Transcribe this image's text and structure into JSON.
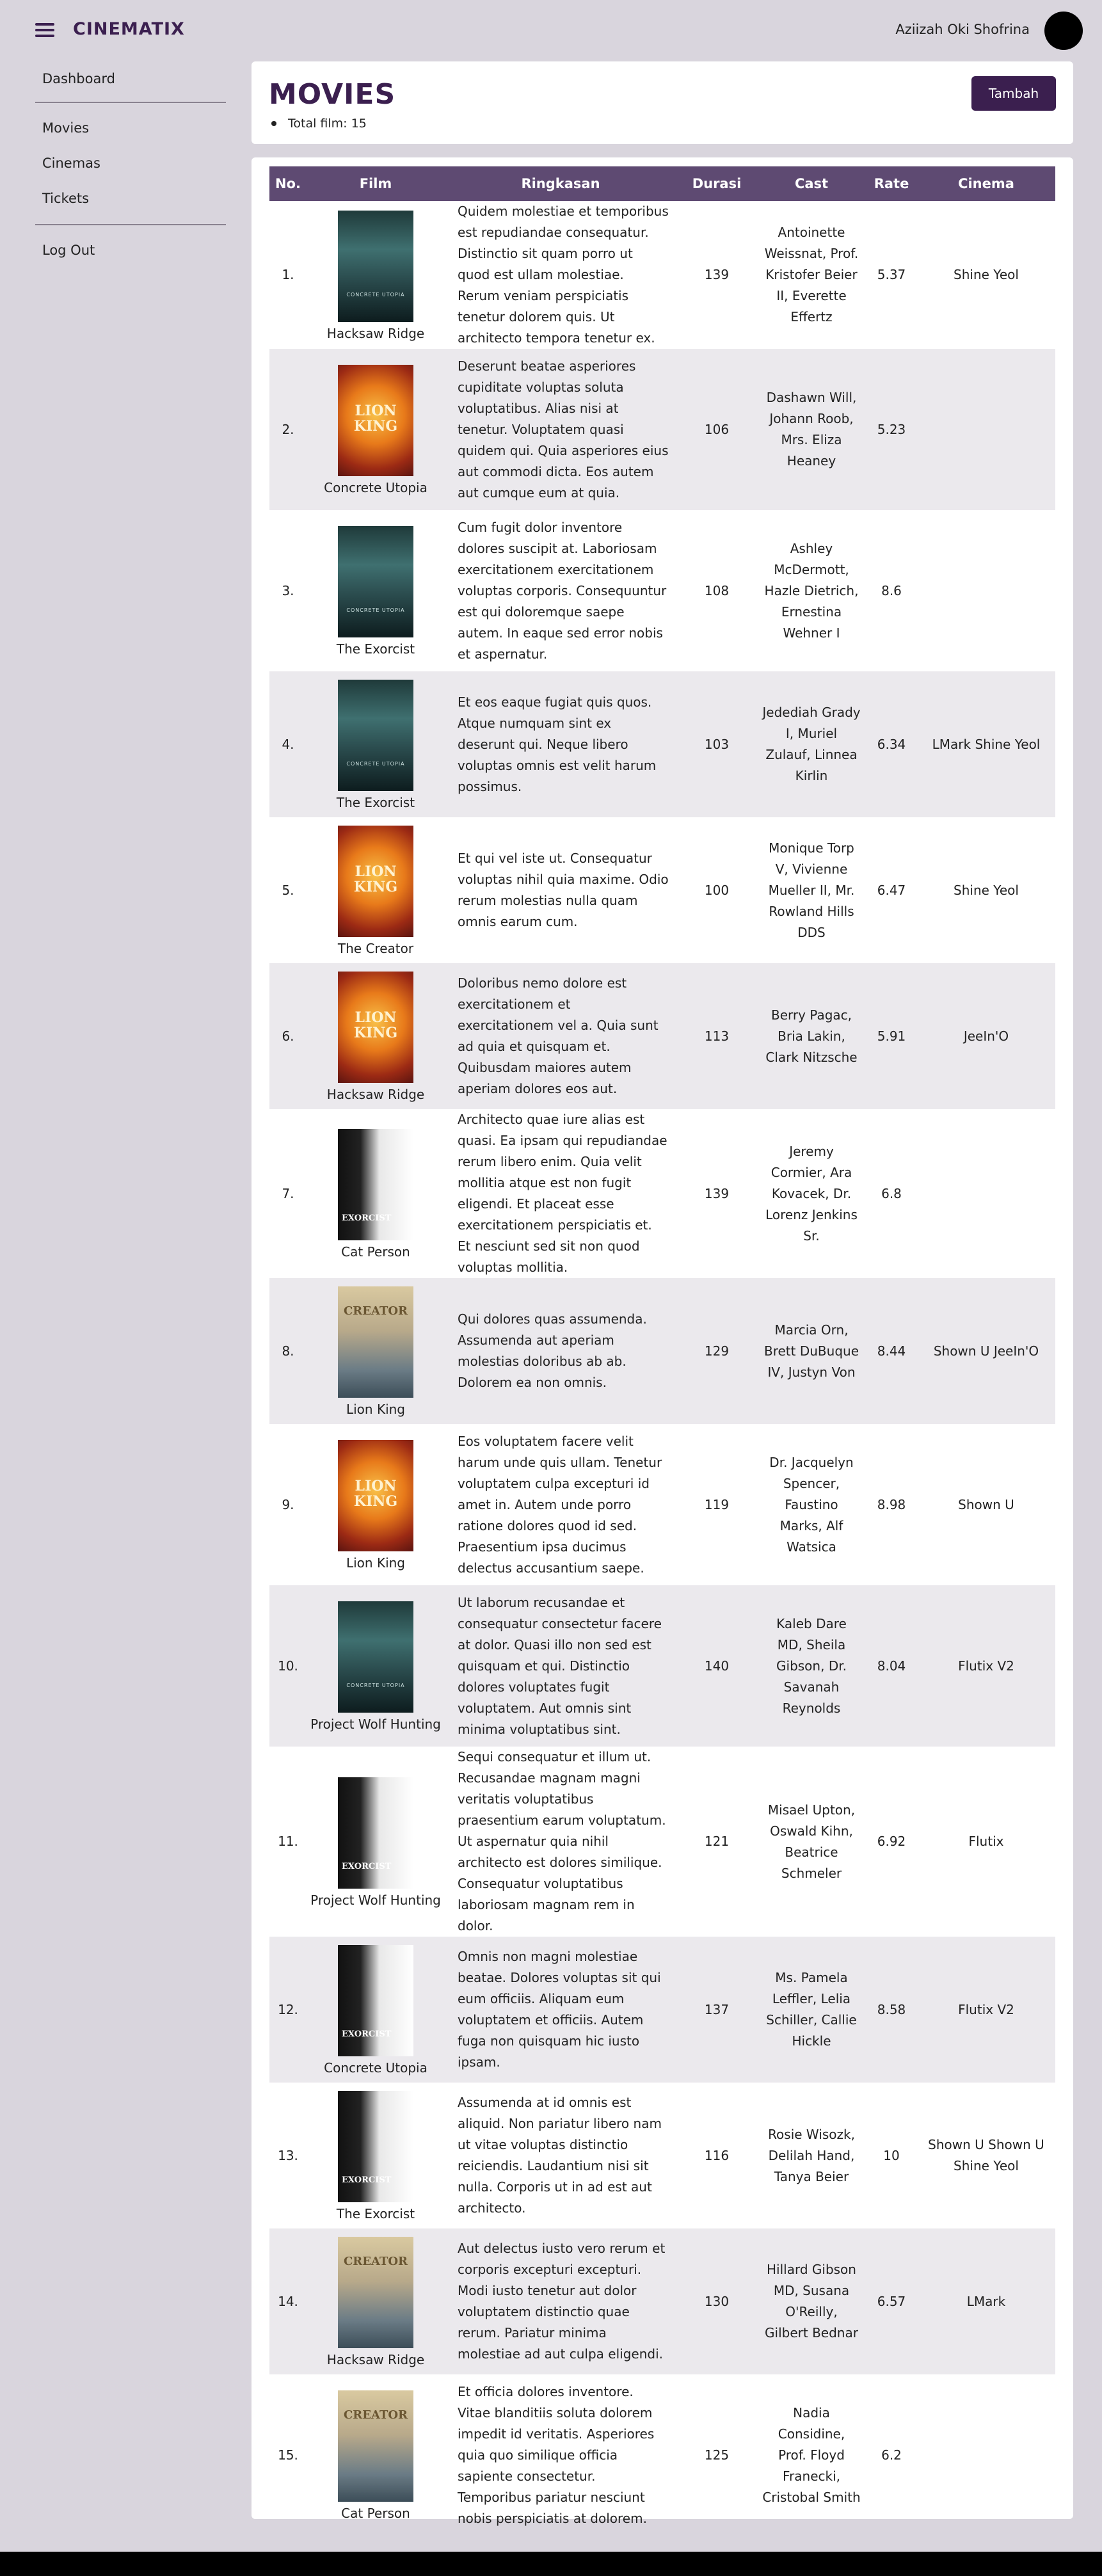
{
  "app": {
    "brand": "CINEMATIX",
    "user_name": "Aziizah Oki Shofrina"
  },
  "sidebar": {
    "items": [
      {
        "label": "Dashboard"
      },
      {
        "label": "Movies"
      },
      {
        "label": "Cinemas"
      },
      {
        "label": "Tickets"
      },
      {
        "label": "Log Out"
      }
    ]
  },
  "header": {
    "title": "MOVIES",
    "total_label": "Total film: 15",
    "add_button": "Tambah"
  },
  "table": {
    "columns": [
      "No.",
      "Film",
      "Ringkasan",
      "Durasi",
      "Cast",
      "Rate",
      "Cinema"
    ],
    "rows": [
      {
        "no": "1.",
        "poster": "concrete-utopia-poster",
        "film": "Hacksaw Ridge",
        "ringkasan": "Quidem molestiae et temporibus est repudiandae consequatur. Distinctio sit quam porro ut quod est ullam molestiae. Rerum veniam perspiciatis tenetur dolorem quis. Ut architecto tempora tenetur ex.",
        "durasi": "139",
        "cast": "Antoinette Weissnat, Prof. Kristofer Beier II, Everette Effertz",
        "rate": "5.37",
        "cinema": "Shine Yeol"
      },
      {
        "no": "2.",
        "poster": "lion-king-poster",
        "film": "Concrete Utopia",
        "ringkasan": "Deserunt beatae asperiores cupiditate voluptas soluta voluptatibus. Alias nisi at tenetur. Voluptatem quasi quidem qui. Quia asperiores eius aut commodi dicta. Eos autem aut cumque eum at quia.",
        "durasi": "106",
        "cast": "Dashawn Will, Johann Roob, Mrs. Eliza Heaney",
        "rate": "5.23",
        "cinema": ""
      },
      {
        "no": "3.",
        "poster": "concrete-utopia-poster",
        "film": "The Exorcist",
        "ringkasan": "Cum fugit dolor inventore dolores suscipit at. Laboriosam exercitationem exercitationem voluptas corporis. Consequuntur est qui doloremque saepe autem. In eaque sed error nobis et aspernatur.",
        "durasi": "108",
        "cast": "Ashley McDermott, Hazle Dietrich, Ernestina Wehner I",
        "rate": "8.6",
        "cinema": ""
      },
      {
        "no": "4.",
        "poster": "concrete-utopia-poster",
        "film": "The Exorcist",
        "ringkasan": "Et eos eaque fugiat quis quos. Atque numquam sint ex deserunt qui. Neque libero voluptas omnis est velit harum possimus.",
        "durasi": "103",
        "cast": "Jedediah Grady I, Muriel Zulauf, Linnea Kirlin",
        "rate": "6.34",
        "cinema": "LMark Shine Yeol"
      },
      {
        "no": "5.",
        "poster": "lion-king-poster",
        "film": "The Creator",
        "ringkasan": "Et qui vel iste ut. Consequatur voluptas nihil quia maxime. Odio rerum molestias nulla quam omnis earum cum.",
        "durasi": "100",
        "cast": "Monique Torp V, Vivienne Mueller II, Mr. Rowland Hills DDS",
        "rate": "6.47",
        "cinema": "Shine Yeol"
      },
      {
        "no": "6.",
        "poster": "lion-king-poster",
        "film": "Hacksaw Ridge",
        "ringkasan": "Doloribus nemo dolore est exercitationem et exercitationem vel a. Quia sunt ad quia et quisquam et. Quibusdam maiores autem aperiam dolores eos aut.",
        "durasi": "113",
        "cast": "Berry Pagac, Bria Lakin, Clark Nitzsche",
        "rate": "5.91",
        "cinema": "JeeIn'O"
      },
      {
        "no": "7.",
        "poster": "exorcist-poster",
        "film": "Cat Person",
        "ringkasan": "Architecto quae iure alias est quasi. Ea ipsam qui repudiandae rerum libero enim. Quia velit mollitia atque est non fugit eligendi. Et placeat esse exercitationem perspiciatis et. Et nesciunt sed sit non quod voluptas mollitia.",
        "durasi": "139",
        "cast": "Jeremy Cormier, Ara Kovacek, Dr. Lorenz Jenkins Sr.",
        "rate": "6.8",
        "cinema": ""
      },
      {
        "no": "8.",
        "poster": "creator-poster",
        "film": "Lion King",
        "ringkasan": "Qui dolores quas assumenda. Assumenda aut aperiam molestias doloribus ab ab. Dolorem ea non omnis.",
        "durasi": "129",
        "cast": "Marcia Orn, Brett DuBuque IV, Justyn Von",
        "rate": "8.44",
        "cinema": "Shown U JeeIn'O"
      },
      {
        "no": "9.",
        "poster": "lion-king-poster",
        "film": "Lion King",
        "ringkasan": "Eos voluptatem facere velit harum unde quis ullam. Tenetur voluptatem culpa excepturi id amet in. Autem unde porro ratione dolores quod id sed. Praesentium ipsa ducimus delectus accusantium saepe.",
        "durasi": "119",
        "cast": "Dr. Jacquelyn Spencer, Faustino Marks, Alf Watsica",
        "rate": "8.98",
        "cinema": "Shown U"
      },
      {
        "no": "10.",
        "poster": "concrete-utopia-poster",
        "film": "Project Wolf Hunting",
        "ringkasan": "Ut laborum recusandae et consequatur consectetur facere at dolor. Quasi illo non sed est quisquam et qui. Distinctio dolores voluptates fugit voluptatem. Aut omnis sint minima voluptatibus sint.",
        "durasi": "140",
        "cast": "Kaleb Dare MD, Sheila Gibson, Dr. Savanah Reynolds",
        "rate": "8.04",
        "cinema": "Flutix V2"
      },
      {
        "no": "11.",
        "poster": "exorcist-poster",
        "film": "Project Wolf Hunting",
        "ringkasan": "Sequi consequatur et illum ut. Recusandae magnam magni veritatis voluptatibus praesentium earum voluptatum. Ut aspernatur quia nihil architecto est dolores similique. Consequatur voluptatibus laboriosam magnam rem in dolor.",
        "durasi": "121",
        "cast": "Misael Upton, Oswald Kihn, Beatrice Schmeler",
        "rate": "6.92",
        "cinema": "Flutix"
      },
      {
        "no": "12.",
        "poster": "exorcist-poster",
        "film": "Concrete Utopia",
        "ringkasan": "Omnis non magni molestiae beatae. Dolores voluptas sit qui eum officiis. Aliquam eum voluptatem et officiis. Autem fuga non quisquam hic iusto ipsam.",
        "durasi": "137",
        "cast": "Ms. Pamela Leffler, Lelia Schiller, Callie Hickle",
        "rate": "8.58",
        "cinema": "Flutix V2"
      },
      {
        "no": "13.",
        "poster": "exorcist-poster",
        "film": "The Exorcist",
        "ringkasan": "Assumenda at id omnis est aliquid. Non pariatur libero nam ut vitae voluptas distinctio reiciendis. Laudantium nisi sit nulla. Corporis ut in ad est aut architecto.",
        "durasi": "116",
        "cast": "Rosie Wisozk, Delilah Hand, Tanya Beier",
        "rate": "10",
        "cinema": "Shown U Shown U Shine Yeol"
      },
      {
        "no": "14.",
        "poster": "creator-poster",
        "film": "Hacksaw Ridge",
        "ringkasan": "Aut delectus iusto vero rerum et corporis excepturi excepturi. Modi iusto tenetur aut dolor voluptatem distinctio quae rerum. Pariatur minima molestiae ad aut culpa eligendi.",
        "durasi": "130",
        "cast": "Hillard Gibson MD, Susana O'Reilly, Gilbert Bednar",
        "rate": "6.57",
        "cinema": "LMark"
      },
      {
        "no": "15.",
        "poster": "creator-poster",
        "film": "Cat Person",
        "ringkasan": "Et officia dolores inventore. Vitae blanditiis soluta dolorem impedit id veritatis. Asperiores quia quo similique officia sapiente consectetur. Temporibus pariatur nesciunt nobis perspiciatis at dolorem.",
        "durasi": "125",
        "cast": "Nadia Considine, Prof. Floyd Franecki, Cristobal Smith",
        "rate": "6.2",
        "cinema": ""
      }
    ]
  },
  "colors": {
    "brand": "#3b1f4f",
    "table_header": "#5e4a72",
    "page_background": "#d9d5dd",
    "row_stripe": "#ebe9ed"
  }
}
